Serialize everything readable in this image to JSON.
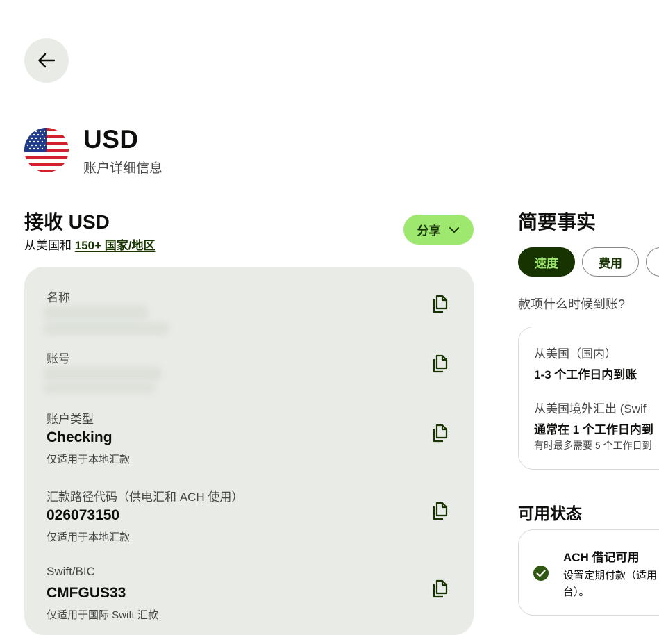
{
  "header": {
    "currency_code": "USD",
    "subtitle": "账户详细信息"
  },
  "receive": {
    "title": "接收 USD",
    "from_prefix": "从美国和",
    "countries_link": "150+ 国家/地区",
    "share_label": "分享"
  },
  "details": {
    "fields": [
      {
        "label": "名称",
        "value": "",
        "note": ""
      },
      {
        "label": "账号",
        "value": "",
        "note": ""
      },
      {
        "label": "账户类型",
        "value": "Checking",
        "note": "仅适用于本地汇款"
      },
      {
        "label": "汇款路径代码（供电汇和 ACH 使用）",
        "value": "026073150",
        "note": "仅适用于本地汇款"
      },
      {
        "label": "Swift/BIC",
        "value": "CMFGUS33",
        "note": "仅适用于国际 Swift 汇款"
      }
    ]
  },
  "facts": {
    "title": "简要事实",
    "tabs": [
      "速度",
      "费用"
    ],
    "question": "款项什么时候到账?",
    "domestic_label": "从美国（国内）",
    "domestic_value": "1-3 个工作日内到账",
    "international_label": "从美国境外汇出 (Swif",
    "international_value": "通常在 1 个工作日内到",
    "international_note": "有时最多需要 5 个工作日到"
  },
  "availability": {
    "title": "可用状态",
    "item_title": "ACH 借记可用",
    "item_desc_line1": "设置定期付款（适用",
    "item_desc_line2": "台）。"
  },
  "colors": {
    "accent_green": "#9fe870",
    "forest_green": "#163300",
    "card_grey": "#e8ebe6"
  },
  "icons": {
    "back": "arrow-left-icon",
    "copy": "copy-icon",
    "share_chevron": "chevron-down-icon",
    "check": "check-circle-icon"
  }
}
